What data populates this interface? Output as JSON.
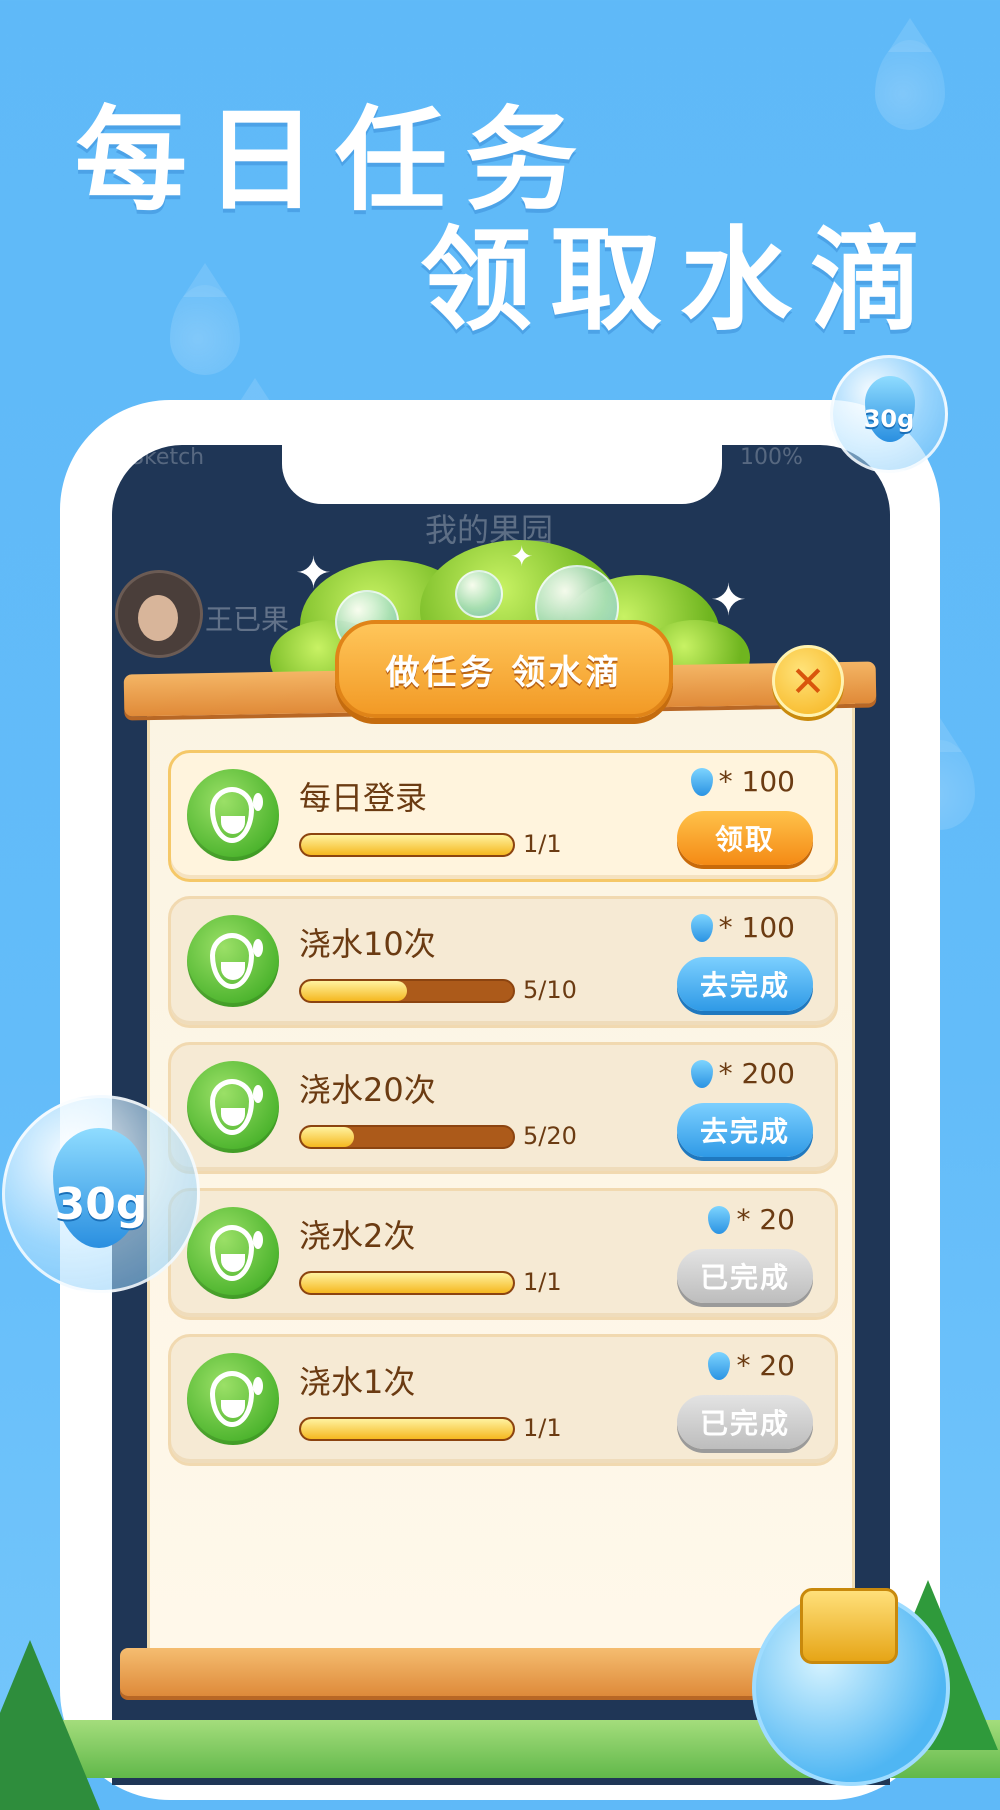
{
  "headline": {
    "line1": "每日任务",
    "line2": "领取水滴"
  },
  "phone": {
    "status_left": "Sketch",
    "status_right": "100%",
    "garden_title": "我的果园",
    "owner_name": "王已果"
  },
  "panel": {
    "banner_title": "做任务 领水滴",
    "close_icon": "✕"
  },
  "tasks": [
    {
      "name": "每日登录",
      "progress_text": "1/1",
      "progress": 1.0,
      "reward": "* 100",
      "button": "领取",
      "state": "claim"
    },
    {
      "name": "浇水10次",
      "progress_text": "5/10",
      "progress": 0.5,
      "reward": "* 100",
      "button": "去完成",
      "state": "go"
    },
    {
      "name": "浇水20次",
      "progress_text": "5/20",
      "progress": 0.25,
      "reward": "* 200",
      "button": "去完成",
      "state": "go"
    },
    {
      "name": "浇水2次",
      "progress_text": "1/1",
      "progress": 1.0,
      "reward": "* 20",
      "button": "已完成",
      "state": "done"
    },
    {
      "name": "浇水1次",
      "progress_text": "1/1",
      "progress": 1.0,
      "reward": "* 20",
      "button": "已完成",
      "state": "done"
    }
  ],
  "bubbles": {
    "small_label": "30g",
    "large_label": "30g"
  },
  "colors": {
    "sky": "#63bcf9",
    "claim_orange": "#f48a15",
    "go_blue": "#2f9ae6",
    "done_gray": "#bdbdbd",
    "progress_brown": "#ac5a1a"
  },
  "icons": {
    "task_icon": "water-drop-icon",
    "reward_icon": "water-drop-icon",
    "close": "close-icon"
  }
}
